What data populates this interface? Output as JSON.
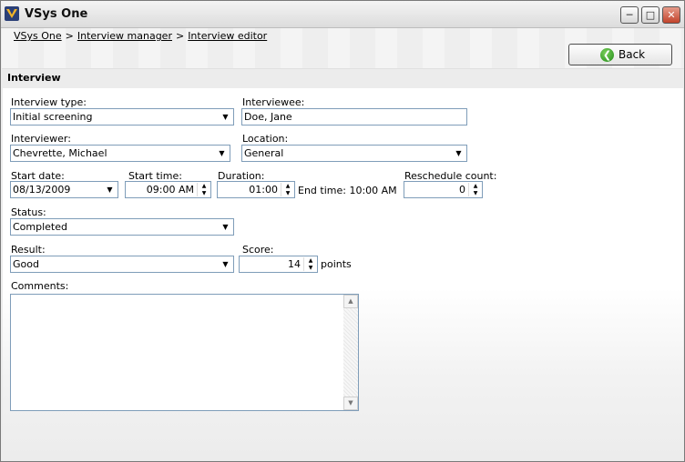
{
  "window": {
    "title": "VSys One"
  },
  "breadcrumb": [
    "VSys One",
    "Interview manager",
    "Interview editor"
  ],
  "back_button": {
    "label": "Back"
  },
  "section": {
    "title": "Interview"
  },
  "form": {
    "interview_type": {
      "label": "Interview type:",
      "value": "Initial screening"
    },
    "interviewee": {
      "label": "Interviewee:",
      "value": "Doe, Jane"
    },
    "interviewer": {
      "label": "Interviewer:",
      "value": "Chevrette, Michael"
    },
    "location": {
      "label": "Location:",
      "value": "General"
    },
    "start_date": {
      "label": "Start date:",
      "value": "08/13/2009"
    },
    "start_time": {
      "label": "Start time:",
      "value": "09:00 AM"
    },
    "duration": {
      "label": "Duration:",
      "value": "01:00"
    },
    "end_time": {
      "text": "End time: 10:00 AM"
    },
    "reschedule_count": {
      "label": "Reschedule count:",
      "value": "0"
    },
    "status": {
      "label": "Status:",
      "value": "Completed"
    },
    "result": {
      "label": "Result:",
      "value": "Good"
    },
    "score": {
      "label": "Score:",
      "value": "14",
      "unit": "points"
    },
    "comments": {
      "label": "Comments:",
      "value": ""
    }
  },
  "icons": {
    "app": "vsys-logo-icon",
    "minimize": "minimize-icon",
    "maximize": "maximize-icon",
    "close": "close-icon",
    "back": "back-arrow-icon",
    "dropdown": "chevron-down-icon"
  },
  "colors": {
    "field_border": "#7f9db9",
    "back_icon": "#2c9a1f"
  }
}
